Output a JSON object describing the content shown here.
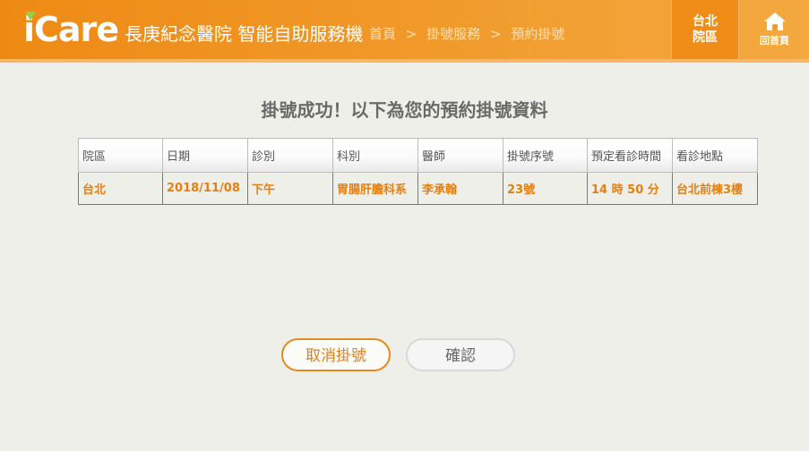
{
  "header": {
    "logo": "iCare",
    "title": "長庚紀念醫院 智能自助服務機",
    "breadcrumb": [
      "首頁",
      ">",
      "掛號服務",
      ">",
      "預約掛號"
    ],
    "campus_line1": "台北",
    "campus_line2": "院區",
    "home_label": "回首頁"
  },
  "main": {
    "heading": "掛號成功！以下為您的預約掛號資料",
    "table": {
      "headers": [
        "院區",
        "日期",
        "診別",
        "科別",
        "醫師",
        "掛號序號",
        "預定看診時間",
        "看診地點"
      ],
      "row": [
        "台北",
        "2018/11/08",
        "下午",
        "胃腸肝膽科系",
        "李承翰",
        "23號",
        "14 時 50 分",
        "台北前棟3樓"
      ]
    },
    "cancel_label": "取消掛號",
    "confirm_label": "確認"
  },
  "colors": {
    "accent": "#ee8a14",
    "accent_text": "#e67f0f",
    "background": "#efefea"
  }
}
